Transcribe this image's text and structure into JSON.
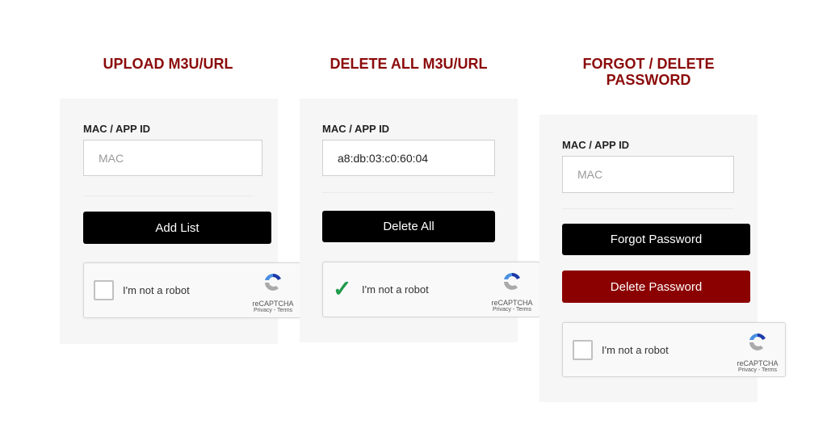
{
  "sections": [
    {
      "title": "UPLOAD M3U/URL",
      "field_label": "MAC / APP ID",
      "input_placeholder": "MAC",
      "input_value": "",
      "buttons": [
        "Add List"
      ],
      "captcha": {
        "text": "I'm not a robot",
        "checked": false,
        "brand": "reCAPTCHA",
        "links": "Privacy - Terms"
      }
    },
    {
      "title": "DELETE ALL M3U/URL",
      "field_label": "MAC / APP ID",
      "input_placeholder": "",
      "input_value": "a8:db:03:c0:60:04",
      "buttons": [
        "Delete All"
      ],
      "captcha": {
        "text": "I'm not a robot",
        "checked": true,
        "brand": "reCAPTCHA",
        "links": "Privacy - Terms"
      }
    },
    {
      "title": "FORGOT / DELETE PASSWORD",
      "field_label": "MAC / APP ID",
      "input_placeholder": "MAC",
      "input_value": "",
      "buttons": [
        "Forgot Password",
        "Delete Password"
      ],
      "captcha": {
        "text": "I'm not a robot",
        "checked": false,
        "brand": "reCAPTCHA",
        "links": "Privacy - Terms"
      }
    }
  ],
  "colors": {
    "title": "#8b0a0a",
    "primary_button": "#000000",
    "danger_button": "#8b0000",
    "check": "#1f9b4a"
  }
}
